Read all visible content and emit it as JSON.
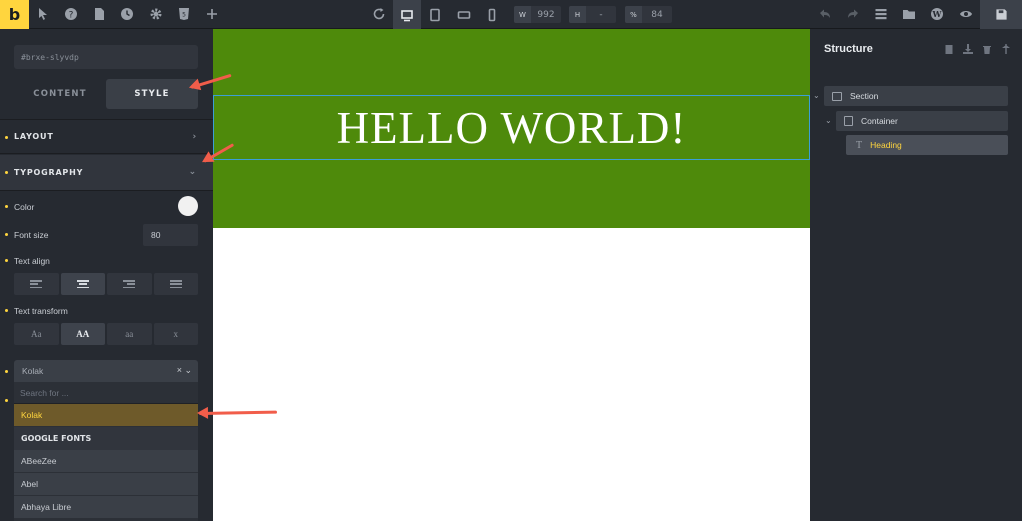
{
  "toolbar": {
    "logo": "b",
    "width_label": "W",
    "width_value": "992",
    "height_label": "H",
    "height_value": "-",
    "zoom_label": "%",
    "zoom_value": "84"
  },
  "panel": {
    "element_id": "#brxe-slyvdp",
    "tabs": {
      "content": "CONTENT",
      "style": "STYLE"
    },
    "sections": {
      "layout": "LAYOUT",
      "typography": "TYPOGRAPHY"
    },
    "color_label": "Color",
    "color_value": "#f1f1f1",
    "font_size_label": "Font size",
    "font_size_value": "80",
    "text_align_label": "Text align",
    "text_transform_label": "Text transform",
    "transform_options": [
      "Aa",
      "AA",
      "aa",
      "x"
    ],
    "font_family_value": "Kolak",
    "font_search_placeholder": "Search for ...",
    "font_options": {
      "selected": "Kolak",
      "group_label": "GOOGLE FONTS",
      "google": [
        "ABeeZee",
        "Abel",
        "Abhaya Libre"
      ]
    }
  },
  "canvas": {
    "heading_text": "HELLO WORLD!",
    "hero_bg": "#4e8a0b"
  },
  "structure": {
    "title": "Structure",
    "tree": [
      {
        "label": "Section",
        "icon": "section-icon"
      },
      {
        "label": "Container",
        "icon": "container-icon"
      },
      {
        "label": "Heading",
        "icon": "heading-icon"
      }
    ]
  },
  "accent": "#ffd53e",
  "annotation_color": "#f15d4a"
}
